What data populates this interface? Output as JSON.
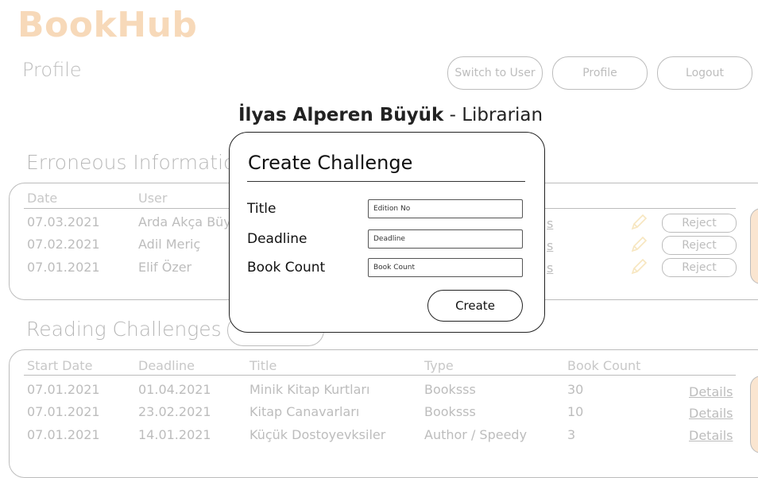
{
  "app": {
    "brand": "BookHub",
    "page_label": "Profile"
  },
  "header": {
    "switch_label": "Switch to User",
    "profile_label": "Profile",
    "logout_label": "Logout"
  },
  "user": {
    "name": "İlyas Alperen Büyük",
    "separator": " - ",
    "role": "Librarian"
  },
  "erroneous": {
    "title": "Erroneous Information",
    "headers": [
      "Date",
      "User"
    ],
    "rows": [
      {
        "date": "07.03.2021",
        "user": "Arda Akça Büyük",
        "link": "s",
        "action": "Reject"
      },
      {
        "date": "07.02.2021",
        "user": "Adil Meriç",
        "link": "s",
        "action": "Reject"
      },
      {
        "date": "07.01.2021",
        "user": "Elif Özer",
        "link": "s",
        "action": "Reject"
      }
    ]
  },
  "challenges": {
    "title": "Reading Challenges",
    "headers": [
      "Start Date",
      "Deadline",
      "Title",
      "Type",
      "Book Count"
    ],
    "rows": [
      {
        "start": "07.01.2021",
        "deadline": "01.04.2021",
        "title": "Minik Kitap Kurtları",
        "type": "Booksss",
        "count": "30",
        "link": "Details"
      },
      {
        "start": "07.01.2021",
        "deadline": "23.02.2021",
        "title": "Kitap Canavarları",
        "type": "Booksss",
        "count": "10",
        "link": "Details"
      },
      {
        "start": "07.01.2021",
        "deadline": "14.01.2021",
        "title": "Küçük Dostoyevksiler",
        "type": "Author / Speedy",
        "count": "3",
        "link": "Details"
      }
    ]
  },
  "modal": {
    "title": "Create Challenge",
    "fields": [
      {
        "label": "Title",
        "placeholder": "Edition No"
      },
      {
        "label": "Deadline",
        "placeholder": "Deadline"
      },
      {
        "label": "Book Count",
        "placeholder": "Book Count"
      }
    ],
    "submit_label": "Create"
  },
  "colors": {
    "brand": "#e98b2a",
    "accent_tab": "#f0b070",
    "pencil": "#e8b23a"
  },
  "icons": {
    "edit": "pencil-icon"
  }
}
